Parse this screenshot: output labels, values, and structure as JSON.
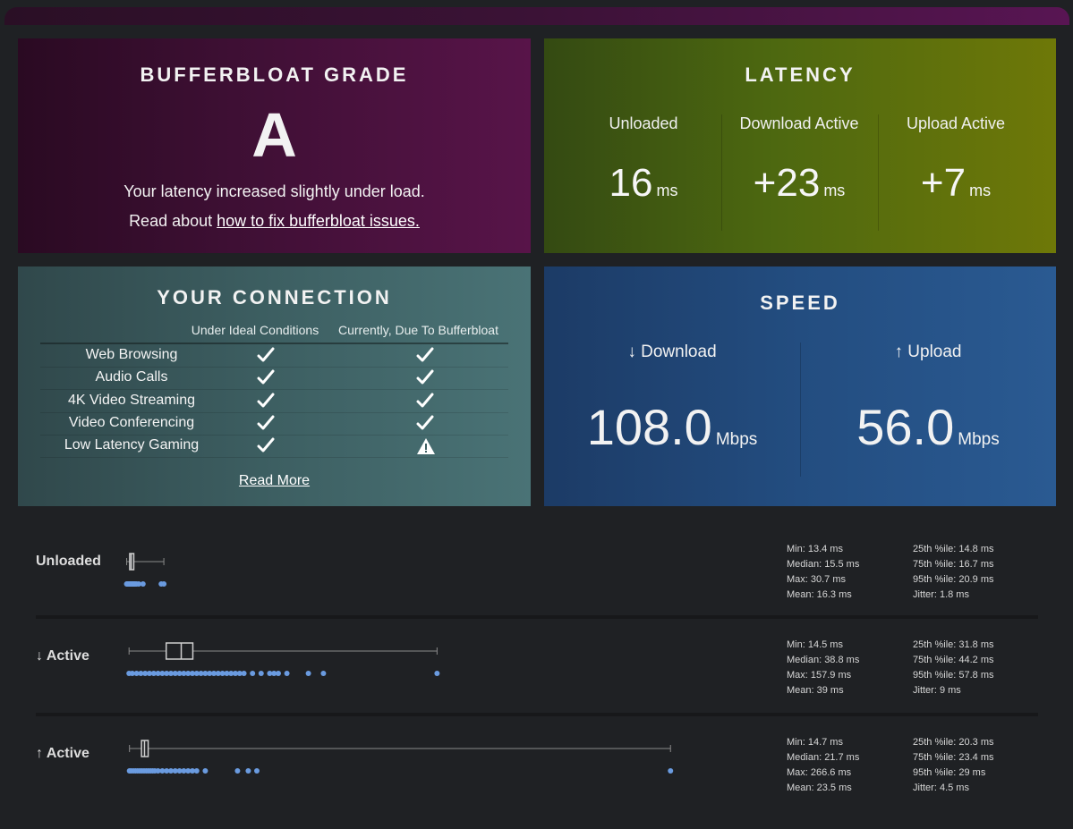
{
  "grade": {
    "title": "BUFFERBLOAT GRADE",
    "letter": "A",
    "description": "Your latency increased slightly under load.",
    "read_prefix": "Read about ",
    "link_text": "how to fix bufferbloat issues."
  },
  "latency": {
    "title": "LATENCY",
    "cols": [
      {
        "label": "Unloaded",
        "value": "16",
        "unit": "ms"
      },
      {
        "label": "Download Active",
        "value": "+23",
        "unit": "ms"
      },
      {
        "label": "Upload Active",
        "value": "+7",
        "unit": "ms"
      }
    ]
  },
  "connection": {
    "title": "YOUR CONNECTION",
    "col1": "Under Ideal Conditions",
    "col2": "Currently, Due To Bufferbloat",
    "rows": [
      {
        "label": "Web Browsing",
        "ideal": "check",
        "current": "check"
      },
      {
        "label": "Audio Calls",
        "ideal": "check",
        "current": "check"
      },
      {
        "label": "4K Video Streaming",
        "ideal": "check",
        "current": "check"
      },
      {
        "label": "Video Conferencing",
        "ideal": "check",
        "current": "check"
      },
      {
        "label": "Low Latency Gaming",
        "ideal": "check",
        "current": "warning"
      }
    ],
    "read_more": "Read More"
  },
  "speed": {
    "title": "SPEED",
    "download": {
      "label": "↓ Download",
      "value": "108.0",
      "unit": "Mbps"
    },
    "upload": {
      "label": "↑ Upload",
      "value": "56.0",
      "unit": "Mbps"
    }
  },
  "details": [
    {
      "label": "Unloaded",
      "box": {
        "min": 13.4,
        "q1": 14.8,
        "median": 15.5,
        "q3": 16.7,
        "max": 30.7
      },
      "points": [
        13.4,
        13.6,
        13.8,
        14.0,
        14.2,
        14.4,
        14.6,
        14.8,
        15.0,
        15.2,
        15.4,
        15.6,
        15.8,
        16.0,
        16.2,
        16.4,
        16.6,
        16.8,
        17.0,
        17.4,
        18.0,
        19.0,
        21.0,
        29.5,
        30.7
      ],
      "stats_left": [
        "Min: 13.4 ms",
        "Median: 15.5 ms",
        "Max: 30.7 ms",
        "Mean: 16.3 ms"
      ],
      "stats_right": [
        "25th %ile: 14.8 ms",
        "75th %ile: 16.7 ms",
        "95th %ile: 20.9 ms",
        "Jitter: 1.8 ms"
      ]
    },
    {
      "label": "↓ Active",
      "box": {
        "min": 14.5,
        "q1": 31.8,
        "median": 38.8,
        "q3": 44.2,
        "max": 157.9
      },
      "points": [
        14.5,
        16,
        18,
        20,
        22,
        24,
        26,
        28,
        30,
        32,
        34,
        36,
        38,
        40,
        42,
        44,
        46,
        48,
        50,
        52,
        54,
        56,
        58,
        60,
        62,
        64,
        66,
        68,
        72,
        76,
        80,
        82,
        84,
        88,
        98,
        105,
        157.9
      ],
      "stats_left": [
        "Min: 14.5 ms",
        "Median: 38.8 ms",
        "Max: 157.9 ms",
        "Mean: 39 ms"
      ],
      "stats_right": [
        "25th %ile: 31.8 ms",
        "75th %ile: 44.2 ms",
        "95th %ile: 57.8 ms",
        "Jitter: 9 ms"
      ]
    },
    {
      "label": "↑ Active",
      "box": {
        "min": 14.7,
        "q1": 20.3,
        "median": 21.7,
        "q3": 23.4,
        "max": 266.6
      },
      "points": [
        14.7,
        15.5,
        16.5,
        17.5,
        18.5,
        19.5,
        20.5,
        21.5,
        22.5,
        23.5,
        24.5,
        25.5,
        26.5,
        28,
        30,
        32,
        34,
        36,
        38,
        40,
        42,
        44,
        46,
        50,
        65,
        70,
        74,
        266.6
      ],
      "stats_left": [
        "Min: 14.7 ms",
        "Median: 21.7 ms",
        "Max: 266.6 ms",
        "Mean: 23.5 ms"
      ],
      "stats_right": [
        "25th %ile: 20.3 ms",
        "75th %ile: 23.4 ms",
        "95th %ile: 29 ms",
        "Jitter: 4.5 ms"
      ]
    }
  ],
  "colors": {
    "point": "#6a9be0",
    "box": "#cfcfcf",
    "whisker": "#8a8a8a"
  }
}
